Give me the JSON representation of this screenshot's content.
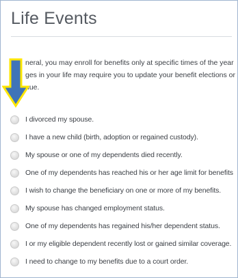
{
  "title": "Life Events",
  "intro": {
    "line1": "neral, you may enroll for benefits only at specific times of the year",
    "line2": "ges in your life may require you to update your benefit elections or",
    "line3": "nue."
  },
  "options": [
    {
      "label": "I divorced my spouse."
    },
    {
      "label": "I have a new child (birth, adoption or regained custody)."
    },
    {
      "label": "My spouse or one of my dependents died recently."
    },
    {
      "label": "One of my dependents has reached his or her age limit for benefits"
    },
    {
      "label": "I wish to change the beneficiary on one or more of my benefits."
    },
    {
      "label": "My spouse has changed employment status."
    },
    {
      "label": "One of my dependents has regained his/her dependent status."
    },
    {
      "label": "I or my eligible dependent recently lost or gained similar coverage."
    },
    {
      "label": "I need to change to my benefits due to a court order."
    }
  ],
  "colors": {
    "arrow_fill": "#3f74b8",
    "arrow_outline": "#ffe600",
    "frame_border": "#9fb4cf"
  }
}
